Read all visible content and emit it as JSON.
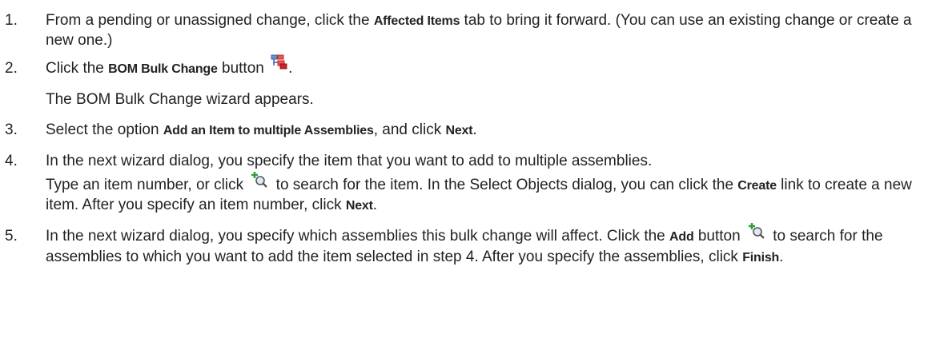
{
  "steps": [
    {
      "num": "1.",
      "t1": "From a pending or unassigned change, click the ",
      "b1": "Affected Items",
      "t2": " tab to bring it forward. (You can use an existing change or create a new one.)"
    },
    {
      "num": "2.",
      "t1": "Click the ",
      "b1": "BOM Bulk Change",
      "t2": " button ",
      "t3": ".",
      "note": "The BOM Bulk Change wizard appears.",
      "icon": "bom-bulk-change-icon"
    },
    {
      "num": "3.",
      "t1": "Select the option ",
      "b1": "Add an Item to multiple Assemblies",
      "t2": ", and click ",
      "b2": "Next",
      "t3": "."
    },
    {
      "num": "4.",
      "line1": "In the next wizard dialog, you specify the item that you want to add to multiple assemblies.",
      "t1": "Type an item number, or click ",
      "t2": " to search for the item. In the Select Objects dialog, you can click the ",
      "b1": "Create",
      "t3": " link to create a new item. After you specify an item number, click ",
      "b2": "Next",
      "t4": ".",
      "icon": "add-search-icon"
    },
    {
      "num": "5.",
      "t1": "In the next wizard dialog, you specify which assemblies this bulk change will affect. Click the ",
      "b1": "Add",
      "t2": " button ",
      "t3": " to search for the assemblies to which you want to add the item selected in step 4. After you specify the assemblies, click ",
      "b2": "Finish",
      "t4": ".",
      "icon": "add-search-icon"
    }
  ],
  "colors": {
    "text": "#222222",
    "icon_red": "#cc2222",
    "icon_green": "#2e9e3a",
    "icon_blue": "#3a5f9e"
  }
}
